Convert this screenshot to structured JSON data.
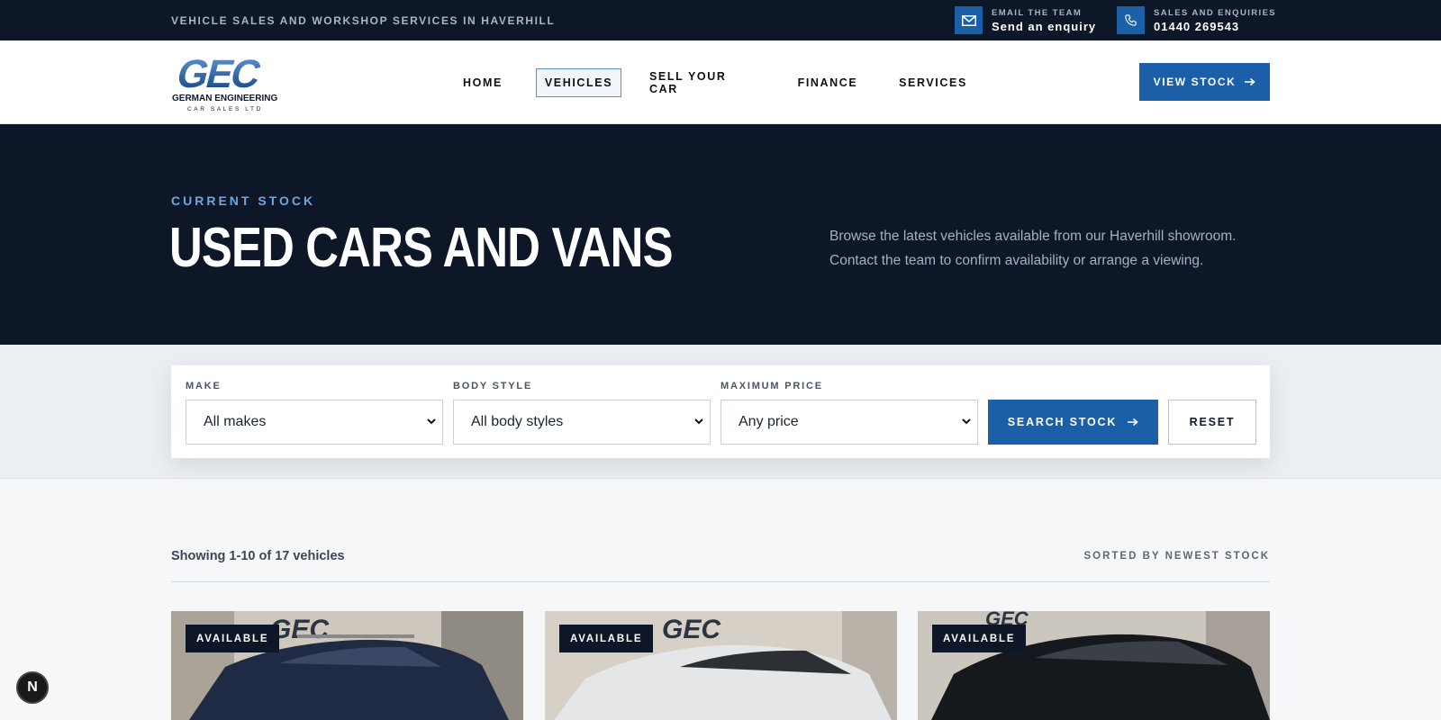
{
  "topbar": {
    "tagline": "VEHICLE SALES AND WORKSHOP SERVICES IN HAVERHILL",
    "email": {
      "label": "EMAIL THE TEAM",
      "value": "Send an enquiry",
      "icon": "mail-icon"
    },
    "phone": {
      "label": "SALES AND ENQUIRIES",
      "value": "01440 269543",
      "icon": "phone-icon"
    }
  },
  "header": {
    "logo": {
      "mark": "GEC",
      "line1": "GERMAN ENGINEERING",
      "line2": "CAR SALES LTD"
    },
    "nav": [
      {
        "label": "HOME",
        "active": false
      },
      {
        "label": "VEHICLES",
        "active": true
      },
      {
        "label": "SELL YOUR CAR",
        "active": false
      },
      {
        "label": "FINANCE",
        "active": false
      },
      {
        "label": "SERVICES",
        "active": false
      }
    ],
    "cta_label": "VIEW STOCK"
  },
  "hero": {
    "eyebrow": "CURRENT STOCK",
    "title": "USED CARS AND VANS",
    "description": "Browse the latest vehicles available from our Haverhill showroom. Contact the team to confirm availability or arrange a viewing."
  },
  "filters": {
    "make": {
      "label": "MAKE",
      "value": "All makes"
    },
    "body_style": {
      "label": "BODY STYLE",
      "value": "All body styles"
    },
    "max_price": {
      "label": "MAXIMUM PRICE",
      "value": "Any price"
    },
    "search_label": "SEARCH STOCK",
    "reset_label": "RESET"
  },
  "results": {
    "showing": "Showing 1-10 of 17 vehicles",
    "sorted": "SORTED BY NEWEST STOCK"
  },
  "cards": [
    {
      "badge": "AVAILABLE",
      "car_color": "#1f2a44",
      "bg": "#cfc9bf"
    },
    {
      "badge": "AVAILABLE",
      "car_color": "#e6e8ea",
      "bg": "#d6d1c8"
    },
    {
      "badge": "AVAILABLE",
      "car_color": "#15181d",
      "bg": "#c9c4bc"
    }
  ],
  "colors": {
    "accent": "#1b5fa8",
    "dark": "#0d1727"
  },
  "float_button": "N"
}
